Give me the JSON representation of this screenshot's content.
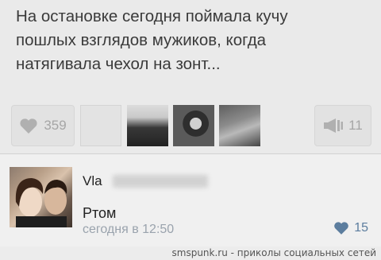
{
  "post": {
    "text": "На остановке сегодня поймала кучу\nпошлых взглядов мужиков, когда\nнатягивала чехол на зонт..."
  },
  "actions": {
    "like_icon": "heart-icon",
    "like_count": "359",
    "share_icon": "megaphone-icon",
    "share_count": "11"
  },
  "liked_by": [
    "placeholder-avatar",
    "photo-couple",
    "photo-person",
    "photo-group"
  ],
  "comment": {
    "author": "Vla",
    "text": "Ртом",
    "time": "сегодня в 12:50",
    "like_icon": "heart-icon",
    "like_count": "15",
    "accent": "#5c7d9e"
  },
  "footer": {
    "credit": "smspunk.ru - приколы социальных сетей"
  }
}
